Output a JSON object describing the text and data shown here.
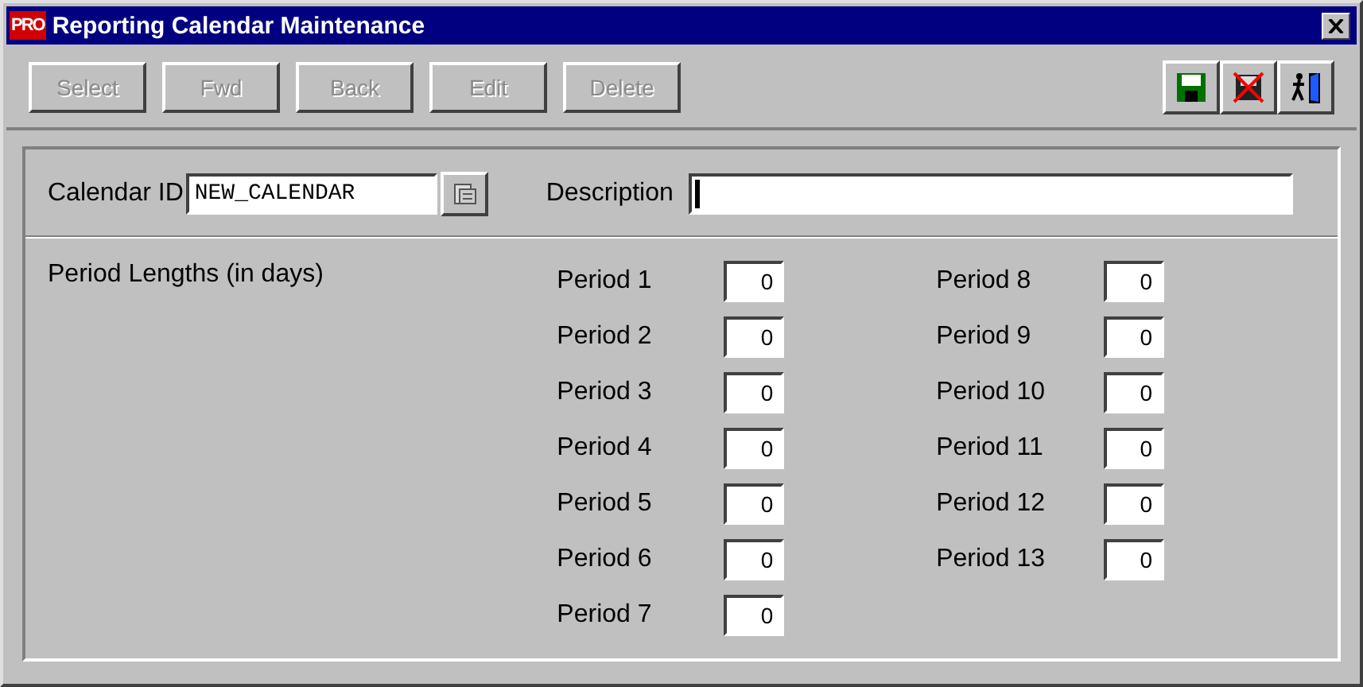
{
  "window": {
    "title": "Reporting Calendar Maintenance",
    "app_badge": "PRO"
  },
  "toolbar": {
    "buttons": [
      {
        "label": "Select",
        "disabled": true
      },
      {
        "label": "Fwd",
        "disabled": true
      },
      {
        "label": "Back",
        "disabled": true
      },
      {
        "label": "Edit",
        "disabled": true
      },
      {
        "label": "Delete",
        "disabled": true
      }
    ],
    "icon_buttons": [
      {
        "kind": "save"
      },
      {
        "kind": "cancel"
      },
      {
        "kind": "exit"
      }
    ]
  },
  "form": {
    "calendar_id": {
      "label": "Calendar ID",
      "value": "NEW_CALENDAR"
    },
    "description": {
      "label": "Description",
      "focused": true
    },
    "period_lengths_label": "Period Lengths (in days)",
    "periods": [
      [
        {
          "label": "Period 1",
          "value": "0"
        },
        {
          "label": "Period 2",
          "value": "0"
        },
        {
          "label": "Period 3",
          "value": "0"
        },
        {
          "label": "Period 4",
          "value": "0"
        },
        {
          "label": "Period 5",
          "value": "0"
        },
        {
          "label": "Period 6",
          "value": "0"
        },
        {
          "label": "Period 7",
          "value": "0"
        }
      ],
      [
        {
          "label": "Period 8",
          "value": "0"
        },
        {
          "label": "Period 9",
          "value": "0"
        },
        {
          "label": "Period 10",
          "value": "0"
        },
        {
          "label": "Period 11",
          "value": "0"
        },
        {
          "label": "Period 12",
          "value": "0"
        },
        {
          "label": "Period 13",
          "value": "0"
        }
      ]
    ]
  }
}
